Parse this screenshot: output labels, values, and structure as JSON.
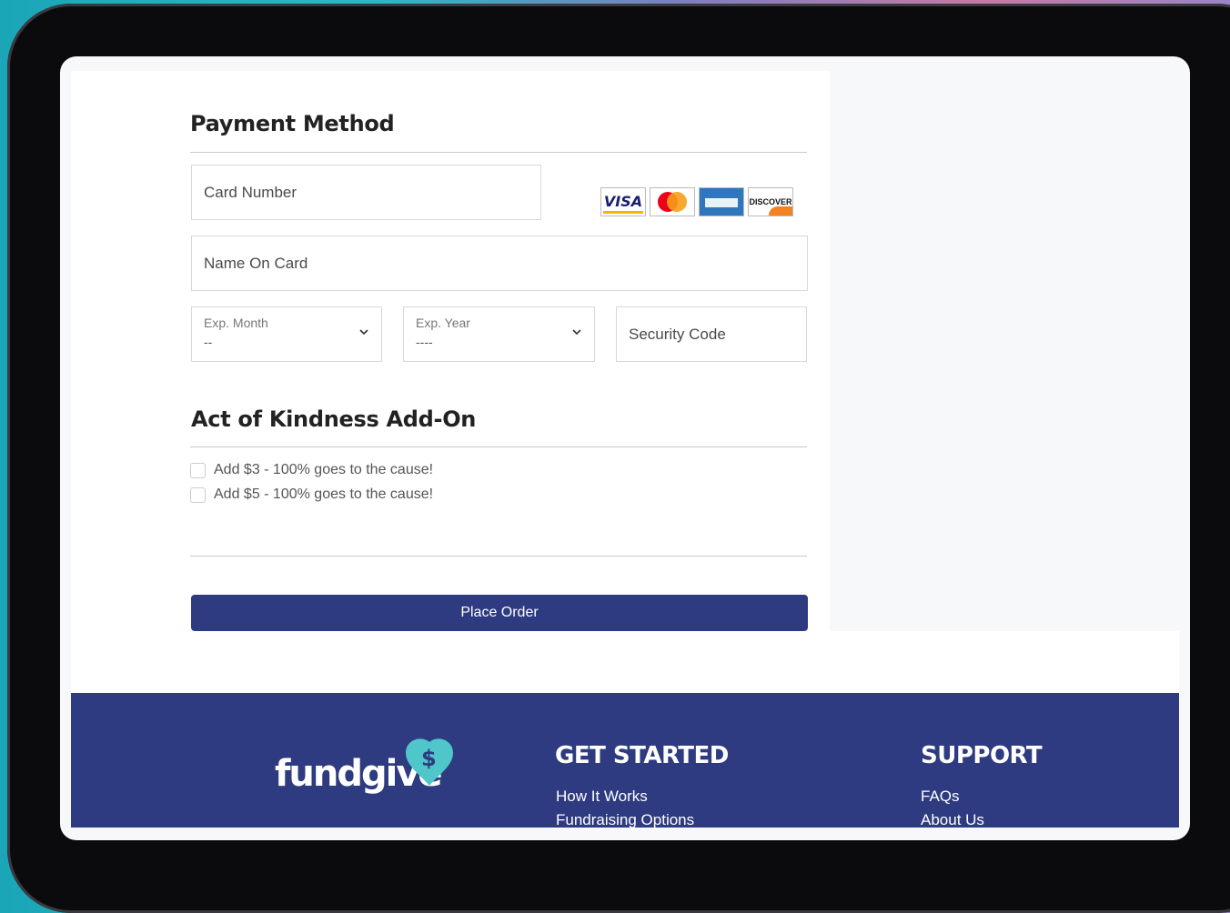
{
  "payment": {
    "heading": "Payment Method",
    "card_number_placeholder": "Card Number",
    "name_on_card_placeholder": "Name On Card",
    "exp_month": {
      "label": "Exp. Month",
      "value": "--"
    },
    "exp_year": {
      "label": "Exp. Year",
      "value": "----"
    },
    "security_code_placeholder": "Security Code",
    "card_brands": {
      "visa": "VISA",
      "mastercard": "mastercard",
      "amex": "AMERICAN EXPRESS",
      "discover": "DISCOVER"
    }
  },
  "addon": {
    "heading": "Act of Kindness Add-On",
    "options": [
      "Add $3 - 100% goes to the cause!",
      "Add $5 - 100% goes to the cause!"
    ]
  },
  "actions": {
    "place_order": "Place Order"
  },
  "footer": {
    "logo_text": "fundgive",
    "get_started": {
      "heading": "GET STARTED",
      "links": [
        "How It Works",
        "Fundraising Options"
      ]
    },
    "support": {
      "heading": "SUPPORT",
      "links": [
        "FAQs",
        "About Us"
      ]
    }
  },
  "colors": {
    "primary": "#2e3b80",
    "logo_teal": "#4fc6c9"
  }
}
